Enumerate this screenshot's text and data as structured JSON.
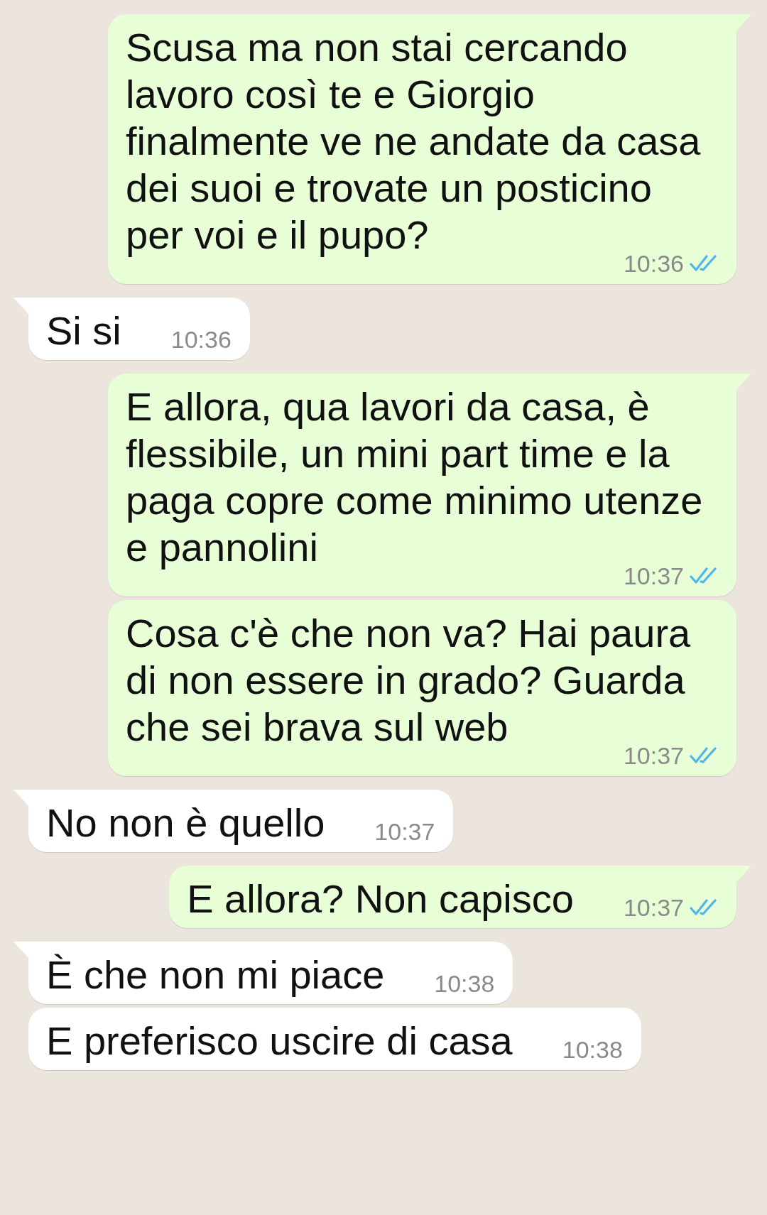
{
  "messages": [
    {
      "outgoing": true,
      "tail": true,
      "text": "Scusa ma non stai cercando lavoro così te e Giorgio finalmente ve ne andate da casa dei suoi e trovate un posticino per voi e il pupo?",
      "time": "10:36",
      "read": true
    },
    {
      "outgoing": false,
      "tail": true,
      "text": "Si si",
      "time": "10:36"
    },
    {
      "outgoing": true,
      "tail": true,
      "text": "E allora, qua lavori da casa, è flessibile, un mini part time e la paga copre come minimo utenze e pannolini",
      "time": "10:37",
      "read": true
    },
    {
      "outgoing": true,
      "tail": false,
      "text": "Cosa c'è che non va? Hai paura di non essere in grado? Guarda che sei brava sul web",
      "time": "10:37",
      "read": true
    },
    {
      "outgoing": false,
      "tail": true,
      "text": "No non è quello",
      "time": "10:37"
    },
    {
      "outgoing": true,
      "tail": true,
      "text": "E allora? Non capisco",
      "time": "10:37",
      "read": true
    },
    {
      "outgoing": false,
      "tail": true,
      "text": "È che non mi piace",
      "time": "10:38"
    },
    {
      "outgoing": false,
      "tail": false,
      "text": "E preferisco uscire di casa",
      "time": "10:38"
    }
  ]
}
